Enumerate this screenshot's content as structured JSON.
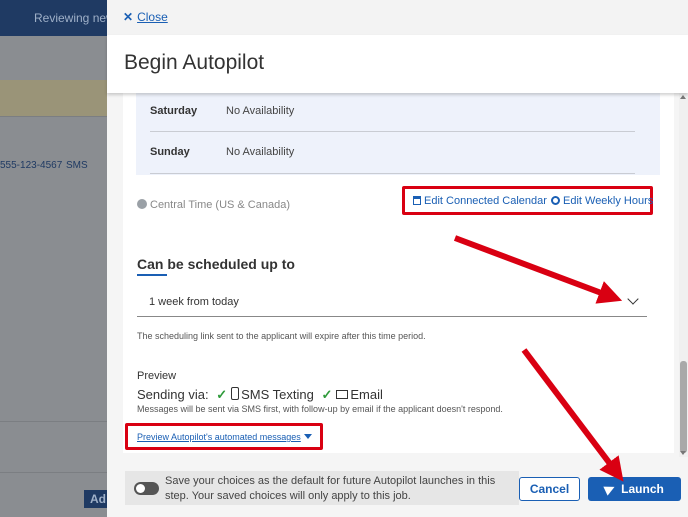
{
  "background": {
    "header_text": "Reviewing new",
    "phone_text": "555-123-4567",
    "sms_label": "SMS",
    "button_label": "Ad"
  },
  "drawer": {
    "close_label": "Close",
    "title": "Begin Autopilot",
    "availability": [
      {
        "day": "Saturday",
        "value": "No Availability"
      },
      {
        "day": "Sunday",
        "value": "No Availability"
      }
    ],
    "timezone": "Central Time (US & Canada)",
    "edit_calendar_label": "Edit Connected Calendar",
    "edit_hours_label": "Edit Weekly Hours",
    "schedule_heading": "Can be scheduled up to",
    "schedule_value": "1 week from today",
    "schedule_help": "The scheduling link sent to the applicant will expire after this time period.",
    "preview_heading": "Preview",
    "sending_via_label": "Sending via:",
    "sms_label": "SMS Texting",
    "email_label": "Email",
    "sending_note": "Messages will be sent via SMS first, with follow-up by email if the applicant doesn't respond.",
    "preview_link": "Preview Autopilot's automated messages",
    "save_choices_text": "Save your choices as the default for future Autopilot launches in this step. Your saved choices will only apply to this job.",
    "cancel_label": "Cancel",
    "launch_label": "Launch"
  },
  "colors": {
    "accent": "#1a5fb4",
    "annotation_red": "#d90012",
    "check_green": "#2e9a3a"
  },
  "icons": [
    "close-icon",
    "globe-icon",
    "calendar-icon",
    "gear-icon",
    "chevron-down-icon",
    "check-icon",
    "phone-icon",
    "mail-icon",
    "caret-down-icon",
    "send-icon"
  ]
}
